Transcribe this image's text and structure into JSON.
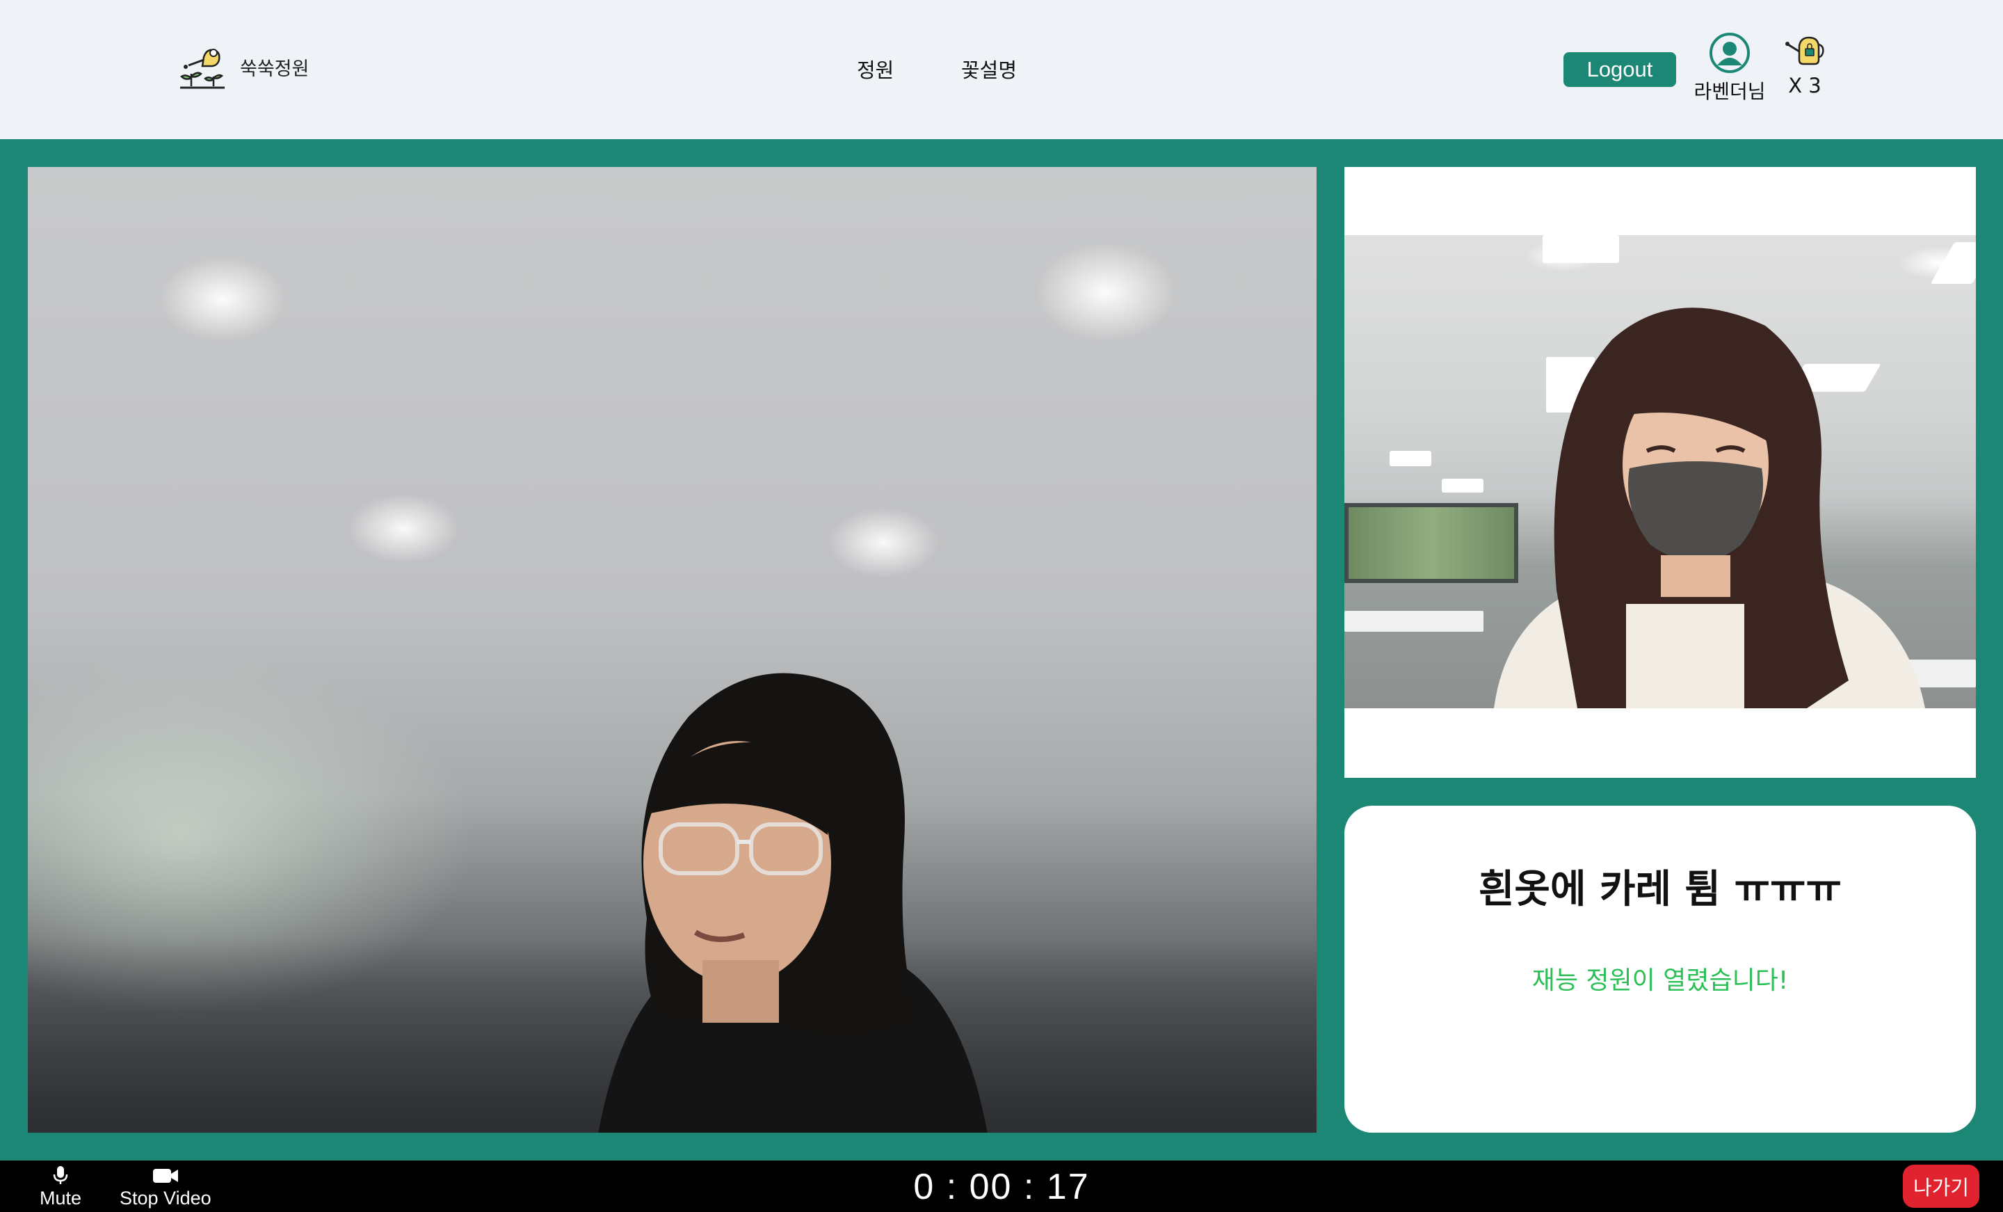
{
  "header": {
    "logo_icon": "watering-can-sprout-icon",
    "brand_name": "쑥쑥정원",
    "nav": [
      {
        "label": "정원"
      },
      {
        "label": "꽃설명"
      }
    ],
    "logout_label": "Logout",
    "user": {
      "avatar_icon": "user-circle-icon",
      "name": "라벤더님"
    },
    "watering_can": {
      "icon": "watering-can-icon",
      "count_label": "X 3"
    }
  },
  "info_card": {
    "title": "흰옷에 카레 튐 ㅠㅠㅠ",
    "subtitle": "재능 정원이 열렸습니다!"
  },
  "controls": {
    "mute_label": "Mute",
    "mute_icon": "microphone-icon",
    "video_label": "Stop Video",
    "video_icon": "video-camera-icon",
    "timer": "0 : 00 : 17",
    "leave_label": "나가기"
  },
  "colors": {
    "brand_green": "#1c8774",
    "header_bg": "#eff3f7",
    "subtitle_green": "#2bbf55",
    "leave_red": "#e0232e"
  }
}
